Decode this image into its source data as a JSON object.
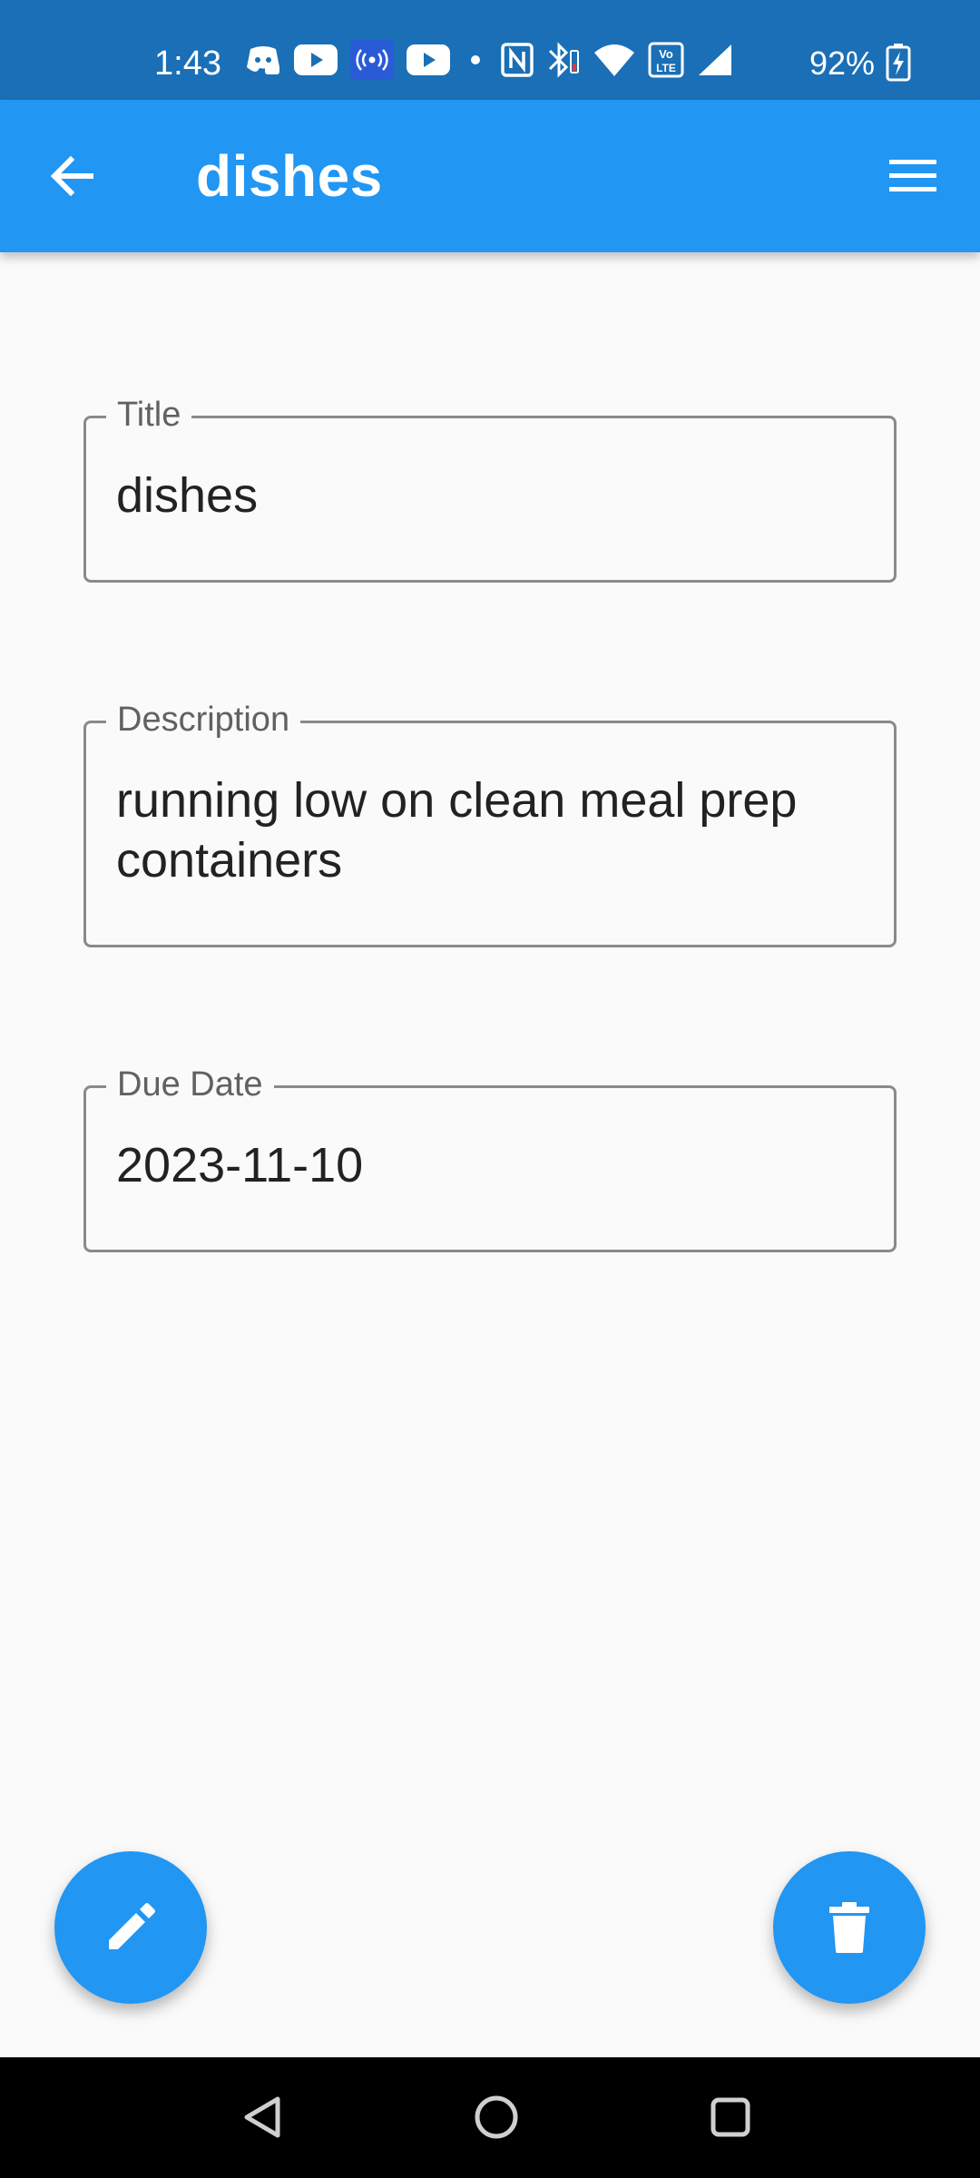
{
  "status_bar": {
    "time": "1:43",
    "battery_percent": "92%",
    "icons": [
      "discord-icon",
      "youtube-icon",
      "hotspot-icon",
      "youtube-icon",
      "dot-icon",
      "nfc-icon",
      "bluetooth-icon",
      "wifi-icon",
      "volte-icon",
      "signal-icon",
      "battery-charging-icon"
    ]
  },
  "app_bar": {
    "title": "dishes",
    "back_icon": "arrow-back-icon",
    "menu_icon": "menu-icon"
  },
  "form": {
    "title": {
      "label": "Title",
      "value": "dishes"
    },
    "description": {
      "label": "Description",
      "value": "running low on clean meal prep containers"
    },
    "due_date": {
      "label": "Due Date",
      "value": "2023-11-10"
    }
  },
  "actions": {
    "edit_icon": "pencil-icon",
    "delete_icon": "trash-icon"
  },
  "colors": {
    "status_bar": "#1a6fb6",
    "app_bar": "#2196f3",
    "fab": "#2196f3",
    "background": "#fafafa",
    "field_border": "#8a8a8a"
  }
}
